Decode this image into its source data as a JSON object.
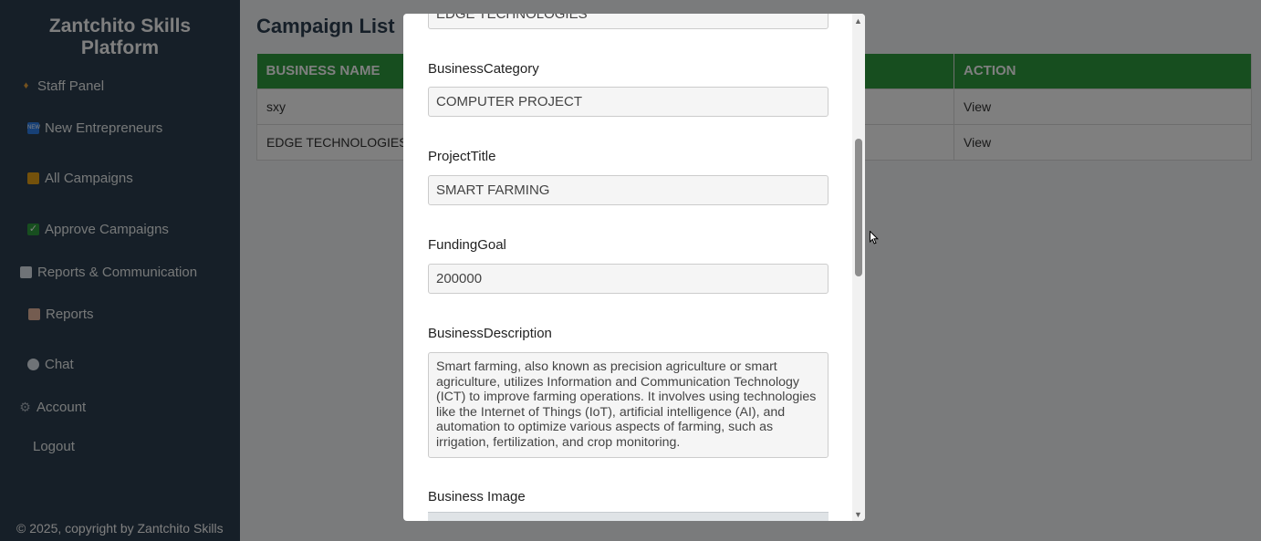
{
  "sidebar": {
    "brand": "Zantchito Skills Platform",
    "staff_panel": "Staff Panel",
    "new_entrepreneurs": "New Entrepreneurs",
    "all_campaigns": "All Campaigns",
    "approve_campaigns": "Approve Campaigns",
    "reports_communication": "Reports & Communication",
    "reports": "Reports",
    "chat": "Chat",
    "account": "Account",
    "logout": "Logout",
    "footer": "© 2025, copyright by Zantchito Skills"
  },
  "main": {
    "title": "Campaign List",
    "columns": [
      "BUSINESS NAME",
      "ACTION"
    ],
    "rows": [
      {
        "business_name": "sxy",
        "action": "View"
      },
      {
        "business_name": "EDGE TECHNOLOGIES",
        "action": "View"
      }
    ]
  },
  "modal": {
    "top_value": "EDGE TECHNOLOGIES",
    "category_label": "BusinessCategory",
    "category_value": "COMPUTER PROJECT",
    "title_label": "ProjectTitle",
    "title_value": "SMART FARMING",
    "goal_label": "FundingGoal",
    "goal_value": "200000",
    "description_label": "BusinessDescription",
    "description_value": "Smart farming, also known as precision agriculture or smart agriculture, utilizes Information and Communication Technology (ICT) to improve farming operations. It involves using technologies like the Internet of Things (IoT), artificial intelligence (AI), and automation to optimize various aspects of farming, such as irrigation, fertilization, and crop monitoring.",
    "image_label": "Business Image"
  },
  "colors": {
    "sidebar_bg": "#2c3e50",
    "table_header_bg": "#2e9c3f",
    "overlay": "rgba(0,0,0,0.5)"
  }
}
